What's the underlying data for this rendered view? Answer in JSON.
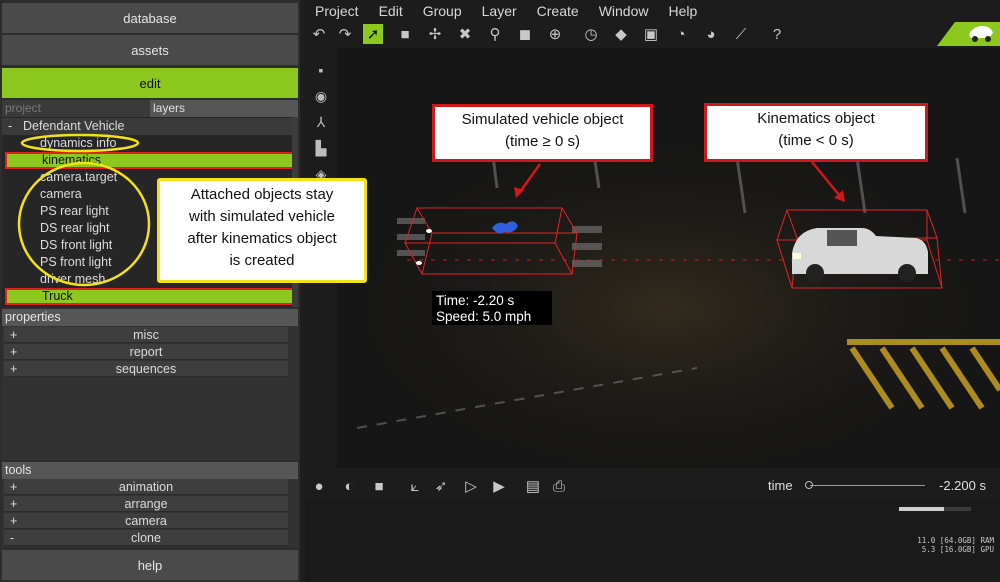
{
  "nav": {
    "database": "database",
    "assets": "assets",
    "edit": "edit",
    "help": "help"
  },
  "tabs": {
    "project": "project",
    "layers": "layers"
  },
  "tree": {
    "root_sign": "-",
    "root": "Defendant Vehicle",
    "items": [
      "dynamics info",
      "kinematics",
      "camera.target",
      "camera",
      "PS rear light",
      "DS rear light",
      "DS front light",
      "PS front light",
      "driver mesh",
      "Truck"
    ]
  },
  "properties": {
    "title": "properties",
    "rows": [
      {
        "sign": "+",
        "label": "misc"
      },
      {
        "sign": "+",
        "label": "report"
      },
      {
        "sign": "+",
        "label": "sequences"
      }
    ]
  },
  "tools": {
    "title": "tools",
    "rows": [
      {
        "sign": "+",
        "label": "animation"
      },
      {
        "sign": "+",
        "label": "arrange"
      },
      {
        "sign": "+",
        "label": "camera"
      },
      {
        "sign": "-",
        "label": "clone"
      }
    ]
  },
  "menu": [
    "Project",
    "Edit",
    "Group",
    "Layer",
    "Create",
    "Window",
    "Help"
  ],
  "bottombar": {
    "time_label": "time",
    "time_value": "-2.200 s"
  },
  "viewport": {
    "readout_time": "Time: -2.20 s",
    "readout_speed": "Speed: 5.0 mph"
  },
  "stats": {
    "ram": "11.0 [64.0GB] RAM",
    "gpu": "5.3 [16.0GB] GPU",
    "progress": 0.62
  },
  "callouts": {
    "simulated": [
      "Simulated vehicle object",
      "(time ≥ 0 s)"
    ],
    "kinematics": [
      "Kinematics object",
      "(time < 0 s)"
    ],
    "attached": [
      "Attached objects stay",
      "with simulated vehicle",
      "after kinematics object",
      "is created"
    ]
  },
  "colors": {
    "accent": "#8cc81e",
    "callout_red": "#d01818",
    "callout_yellow": "#f2e21a"
  },
  "icons": [
    "undo-icon",
    "redo-icon",
    "select-arrow-icon",
    "box-icon",
    "pin-icon",
    "delete-icon",
    "zoom-icon",
    "cube-icon",
    "move-icon",
    "rotate-icon",
    "paint-icon",
    "window-icon",
    "gauge-icon",
    "speed-icon",
    "ruler-icon",
    "help-icon"
  ]
}
